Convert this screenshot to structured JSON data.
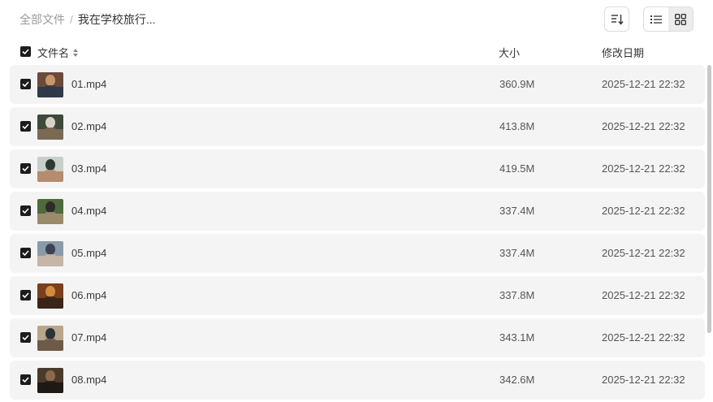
{
  "breadcrumb": {
    "root": "全部文件",
    "separator": "/",
    "current": "我在学校旅行..."
  },
  "toolbar": {
    "sort_icon": "sort-descending-icon",
    "list_view_icon": "list-view-icon",
    "grid_view_icon": "grid-view-icon",
    "active_view": "list"
  },
  "table": {
    "columns": {
      "name": "文件名",
      "size": "大小",
      "date": "修改日期"
    },
    "all_selected": true,
    "rows": [
      {
        "name": "01.mp4",
        "size": "360.9M",
        "date": "2025-12-21 22:32",
        "selected": true,
        "thumb_colors": [
          "#6b4a3a",
          "#c9956a",
          "#2f3a4a"
        ]
      },
      {
        "name": "02.mp4",
        "size": "413.8M",
        "date": "2025-12-21 22:32",
        "selected": true,
        "thumb_colors": [
          "#3d4a3b",
          "#d8d2c4",
          "#7a6a55"
        ]
      },
      {
        "name": "03.mp4",
        "size": "419.5M",
        "date": "2025-12-21 22:32",
        "selected": true,
        "thumb_colors": [
          "#c7cfc9",
          "#2e3b33",
          "#b58c6e"
        ]
      },
      {
        "name": "04.mp4",
        "size": "337.4M",
        "date": "2025-12-21 22:32",
        "selected": true,
        "thumb_colors": [
          "#4f6a3c",
          "#2c2c2a",
          "#9a8b6b"
        ]
      },
      {
        "name": "05.mp4",
        "size": "337.4M",
        "date": "2025-12-21 22:32",
        "selected": true,
        "thumb_colors": [
          "#8a9aa8",
          "#3b4452",
          "#c4b6a8"
        ]
      },
      {
        "name": "06.mp4",
        "size": "337.8M",
        "date": "2025-12-21 22:32",
        "selected": true,
        "thumb_colors": [
          "#7a3f1e",
          "#d68a3c",
          "#3a2418"
        ]
      },
      {
        "name": "07.mp4",
        "size": "343.1M",
        "date": "2025-12-21 22:32",
        "selected": true,
        "thumb_colors": [
          "#b8a58a",
          "#2b3338",
          "#6e5a48"
        ]
      },
      {
        "name": "08.mp4",
        "size": "342.6M",
        "date": "2025-12-21 22:32",
        "selected": true,
        "thumb_colors": [
          "#4a3a2a",
          "#8a6a4a",
          "#1e1a16"
        ]
      }
    ]
  }
}
